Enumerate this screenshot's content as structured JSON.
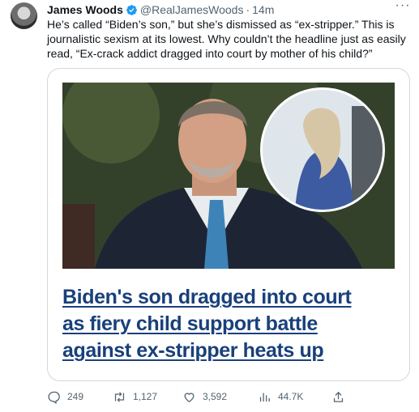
{
  "tweet": {
    "author_name": "James Woods",
    "handle": "@RealJamesWoods",
    "separator": "·",
    "time": "14m",
    "more_label": "···",
    "text": "He’s called “Biden’s son,” but she’s dismissed as “ex-stripper.” This is journalistic sexism at its lowest. Why couldn’t the headline just as easily read, “Ex-crack addict dragged into court by mother of his child?”",
    "verified_color": "#1d9bf0"
  },
  "card": {
    "headline_lines": [
      "Biden's son dragged into court",
      "as fiery child support battle",
      "against ex-stripper heats up"
    ],
    "headline_color": "#19407a"
  },
  "actions": {
    "reply_count": "249",
    "retweet_count": "1,127",
    "like_count": "3,592",
    "views_count": "44.7K",
    "icons": [
      "reply-icon",
      "retweet-icon",
      "like-icon",
      "views-icon",
      "share-icon"
    ]
  }
}
